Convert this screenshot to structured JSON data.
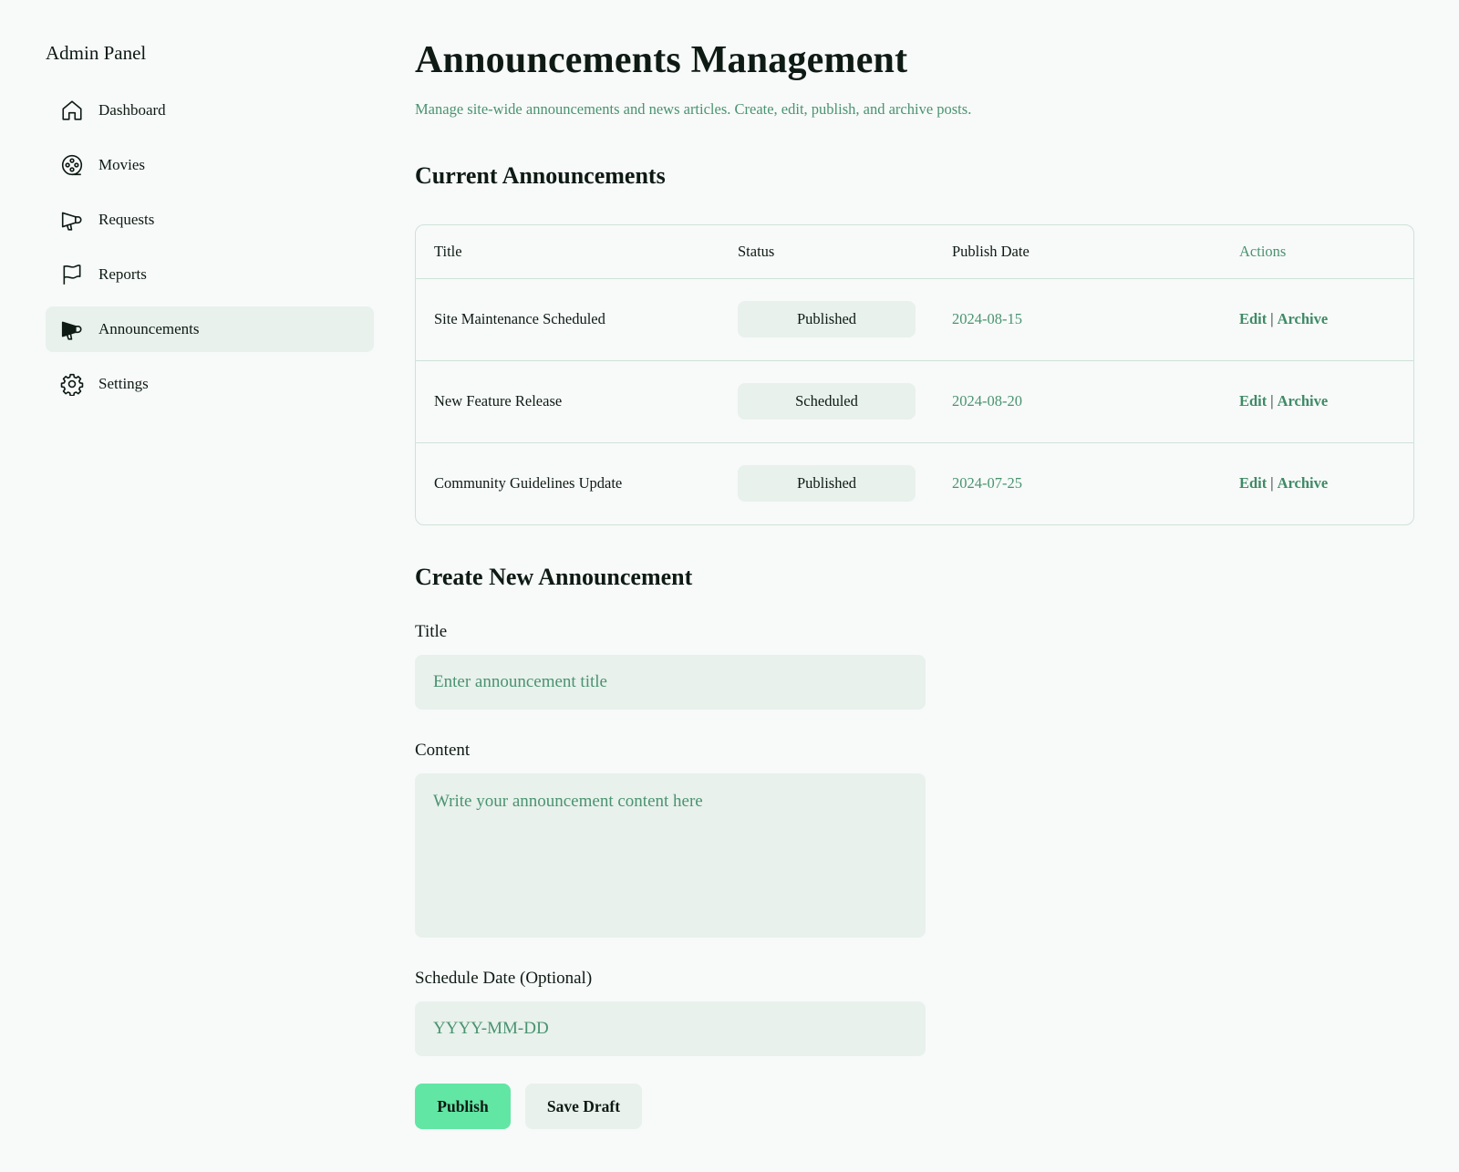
{
  "sidebar": {
    "brand": "Admin Panel",
    "items": [
      {
        "label": "Dashboard",
        "icon": "home-icon"
      },
      {
        "label": "Movies",
        "icon": "film-reel-icon"
      },
      {
        "label": "Requests",
        "icon": "megaphone-outline-icon"
      },
      {
        "label": "Reports",
        "icon": "flag-icon"
      },
      {
        "label": "Announcements",
        "icon": "megaphone-filled-icon",
        "active": true
      },
      {
        "label": "Settings",
        "icon": "gear-icon"
      }
    ]
  },
  "header": {
    "title": "Announcements Management",
    "subtitle": "Manage site-wide announcements and news articles. Create, edit, publish, and archive posts."
  },
  "current": {
    "section_title": "Current Announcements",
    "columns": [
      "Title",
      "Status",
      "Publish Date",
      "Actions"
    ],
    "rows": [
      {
        "title": "Site Maintenance Scheduled",
        "status": "Published",
        "date": "2024-08-15",
        "edit": "Edit",
        "sep": "|",
        "archive": "Archive"
      },
      {
        "title": "New Feature Release",
        "status": "Scheduled",
        "date": "2024-08-20",
        "edit": "Edit",
        "sep": "|",
        "archive": "Archive"
      },
      {
        "title": "Community Guidelines Update",
        "status": "Published",
        "date": "2024-07-25",
        "edit": "Edit",
        "sep": "|",
        "archive": "Archive"
      }
    ]
  },
  "create": {
    "section_title": "Create New Announcement",
    "title_label": "Title",
    "title_placeholder": "Enter announcement title",
    "content_label": "Content",
    "content_placeholder": "Write your announcement content here",
    "date_label": "Schedule Date (Optional)",
    "date_placeholder": "YYYY-MM-DD",
    "publish_label": "Publish",
    "draft_label": "Save Draft"
  },
  "colors": {
    "accent": "#4a9370",
    "primary_button": "#62e6a4",
    "surface": "#e8f1ec",
    "background": "#f7faf9"
  }
}
